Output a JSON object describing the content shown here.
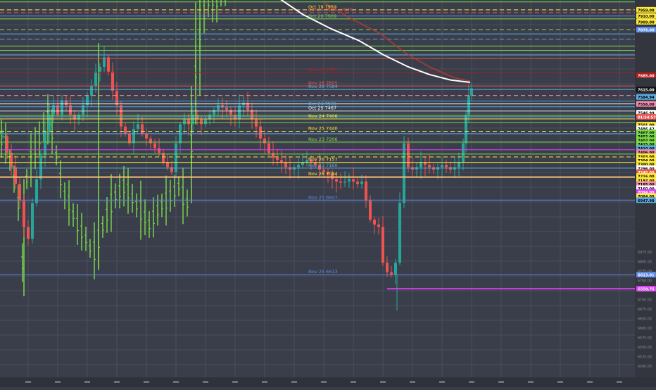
{
  "chart_data": {
    "type": "candlestick",
    "title": "",
    "xlabel": "",
    "ylabel": "",
    "grid": true,
    "ylim": [
      6420,
      8000
    ],
    "colors": {
      "background": "#3a3e4a",
      "grid": "#4a4f5c",
      "up_candle": "#26a69a",
      "down_candle": "#ef5350",
      "green_bars": "#7ddc4a",
      "moving_average": "#ffffff",
      "moving_average_2": "#c0392b",
      "magenta_level": "#e040fb"
    },
    "price_scale_labels": [
      {
        "text": "7959.00",
        "value": 7959,
        "bg": "#ffeb3b",
        "fg": "#000000"
      },
      {
        "text": "7910.00",
        "value": 7933,
        "bg": "#ffeb3b",
        "fg": "#000000"
      },
      {
        "text": "7909.00",
        "value": 7909,
        "bg": "#ffeb3b",
        "fg": "#000000"
      },
      {
        "text": "7876.00",
        "value": 7876,
        "bg": "#5c8ae6",
        "fg": "#ffffff"
      },
      {
        "text": "7685.00",
        "value": 7685,
        "bg": "#b71c1c",
        "fg": "#ffffff"
      },
      {
        "text": "7615.00",
        "value": 7625,
        "bg": "#111111",
        "fg": "#ffffff"
      },
      {
        "text": "7584.94",
        "value": 7594,
        "bg": "#5dade2",
        "fg": "#000000"
      },
      {
        "text": "7556.00",
        "value": 7565,
        "bg": "#f48fb1",
        "fg": "#000000"
      },
      {
        "text": "7546.99",
        "value": 7528,
        "bg": "#ffffff",
        "fg": "#000000"
      },
      {
        "text": "01:54:57",
        "value": 7511,
        "bg": "#ef5350",
        "fg": "#ffffff"
      },
      {
        "text": "7501.00",
        "value": 7478,
        "bg": "#ffeb3b",
        "fg": "#000000"
      },
      {
        "text": "7486.42",
        "value": 7462,
        "bg": "#ffffff",
        "fg": "#000000"
      },
      {
        "text": "7467.00",
        "value": 7446,
        "bg": "#7ddc4a",
        "fg": "#000000"
      },
      {
        "text": "7452.00",
        "value": 7429,
        "bg": "#7ddc4a",
        "fg": "#000000"
      },
      {
        "text": "7402.00",
        "value": 7413,
        "bg": "#7ddc4a",
        "fg": "#000000"
      },
      {
        "text": "7415.00",
        "value": 7397,
        "bg": "#7ddc4a",
        "fg": "#000000"
      },
      {
        "text": "7410.00",
        "value": 7380,
        "bg": "#5dade2",
        "fg": "#000000"
      },
      {
        "text": "7406.00",
        "value": 7363,
        "bg": "#f48fb1",
        "fg": "#000000"
      },
      {
        "text": "7303.00",
        "value": 7346,
        "bg": "#ffeb3b",
        "fg": "#000000"
      },
      {
        "text": "7304.00",
        "value": 7329,
        "bg": "#ffeb3b",
        "fg": "#000000"
      },
      {
        "text": "7300.00",
        "value": 7313,
        "bg": "#ffeb3b",
        "fg": "#000000"
      },
      {
        "text": "7296.00",
        "value": 7296,
        "bg": "#ffffff",
        "fg": "#000000"
      },
      {
        "text": "7245.00",
        "value": 7279,
        "bg": "#ef5350",
        "fg": "#ffffff"
      },
      {
        "text": "7216.00",
        "value": 7263,
        "bg": "#ffeb3b",
        "fg": "#000000"
      },
      {
        "text": "7197.00",
        "value": 7246,
        "bg": "#ffeb3b",
        "fg": "#000000"
      },
      {
        "text": "7185.00",
        "value": 7229,
        "bg": "#f48fb1",
        "fg": "#000000"
      },
      {
        "text": "7160.00",
        "value": 7212,
        "bg": "#ffffff",
        "fg": "#000000"
      },
      {
        "text": "7094.00",
        "value": 7196,
        "bg": "#e040fb",
        "fg": "#ffffff"
      },
      {
        "text": "7084.00",
        "value": 7179,
        "bg": "#ffeb3b",
        "fg": "#000000"
      },
      {
        "text": "6947.98",
        "value": 7162,
        "bg": "#5dade2",
        "fg": "#000000"
      },
      {
        "text": "6613.01",
        "value": 6850,
        "bg": "#5c8ae6",
        "fg": "#ffffff"
      },
      {
        "text": "6550.75",
        "value": 6791,
        "bg": "#e040fb",
        "fg": "#ffffff"
      }
    ],
    "levels": [
      {
        "value": 7992,
        "color": "#7ddc4a",
        "style": "solid"
      },
      {
        "value": 7959,
        "color": "#ffeb3b",
        "style": "dashed",
        "label": "Oct 19 7959"
      },
      {
        "value": 7947,
        "color": "#ef5350",
        "style": "dashed",
        "label": "Oct 25 7959 - 7875"
      },
      {
        "value": 7933,
        "color": "#5c8ae6",
        "style": "solid"
      },
      {
        "value": 7921,
        "color": "#7ddc4a",
        "style": "solid",
        "label": "Oct 20 7909"
      },
      {
        "value": 7876,
        "color": "#7ddc4a",
        "style": "dashed"
      },
      {
        "value": 7858,
        "color": "#5dade2",
        "style": "solid"
      },
      {
        "value": 7836,
        "color": "#5dade2",
        "style": "dashed"
      },
      {
        "value": 7807,
        "color": "#7ddc4a",
        "style": "solid"
      },
      {
        "value": 7789,
        "color": "#7ddc4a",
        "style": "solid"
      },
      {
        "value": 7770,
        "color": "#5dade2",
        "style": "solid"
      },
      {
        "value": 7755,
        "color": "#ef5350",
        "style": "solid"
      },
      {
        "value": 7696,
        "color": "#b71c1c",
        "style": "solid",
        "label": "Nov 26 7685"
      },
      {
        "value": 7640,
        "color": "#ef5350",
        "style": "solid",
        "label": "Nov 28 7605"
      },
      {
        "value": 7625,
        "color": "#5dade2",
        "style": "solid",
        "label": "Nov 28 7584"
      },
      {
        "value": 7600,
        "color": "#f48fb1",
        "style": "dashed"
      },
      {
        "value": 7577,
        "color": "#5dade2",
        "style": "solid"
      },
      {
        "value": 7565,
        "color": "#ffffff",
        "style": "solid"
      },
      {
        "value": 7553,
        "color": "#5dade2",
        "style": "solid",
        "label": "Oct 24 7581"
      },
      {
        "value": 7535,
        "color": "#ffffff",
        "style": "solid",
        "label": "Oct 25 7467"
      },
      {
        "value": 7517,
        "color": "#7ddc4a",
        "style": "solid"
      },
      {
        "value": 7511,
        "color": "#5dade2",
        "style": "solid"
      },
      {
        "value": 7502,
        "color": "#ffeb3b",
        "style": "solid",
        "label": "Nov 24 7406"
      },
      {
        "value": 7486,
        "color": "#7ddc4a",
        "style": "solid"
      },
      {
        "value": 7450,
        "color": "#ffeb3b",
        "style": "dashed",
        "label": "Nov 25 7440"
      },
      {
        "value": 7440,
        "color": "#5dade2",
        "style": "solid"
      },
      {
        "value": 7405,
        "color": "#7ddc4a",
        "style": "solid",
        "label": "Nov 23 7206"
      },
      {
        "value": 7373,
        "color": "#e040fb",
        "style": "solid"
      },
      {
        "value": 7355,
        "color": "#7ddc4a",
        "style": "solid"
      },
      {
        "value": 7343,
        "color": "#ffeb3b",
        "style": "dashed"
      },
      {
        "value": 7320,
        "color": "#ffeb3b",
        "style": "solid",
        "label": "Nov 26 7157"
      },
      {
        "value": 7296,
        "color": "#5dade2",
        "style": "solid",
        "label": "Nov 23 7160"
      },
      {
        "value": 7260,
        "color": "#ffeb3b",
        "style": "solid",
        "label": "Nov 26 7084"
      },
      {
        "value": 7256,
        "color": "#f48fb1",
        "style": "solid"
      },
      {
        "value": 7162,
        "color": "#5c8ae6",
        "style": "solid",
        "label": "Nov 25 6947"
      },
      {
        "value": 6850,
        "color": "#5c8ae6",
        "style": "solid",
        "label": "Nov 25 6613"
      },
      {
        "value": 6791,
        "color": "#e040fb",
        "style": "solid",
        "x_start_fraction": 0.59,
        "width": 2
      }
    ],
    "moving_average": [
      [
        395,
        8010
      ],
      [
        430,
        7940
      ],
      [
        470,
        7880
      ],
      [
        510,
        7830
      ],
      [
        545,
        7770
      ],
      [
        580,
        7720
      ],
      [
        610,
        7688
      ],
      [
        640,
        7665
      ],
      [
        668,
        7655
      ]
    ],
    "moving_average_2": [
      [
        460,
        7990
      ],
      [
        500,
        7920
      ],
      [
        540,
        7860
      ],
      [
        575,
        7780
      ],
      [
        610,
        7720
      ],
      [
        645,
        7675
      ],
      [
        668,
        7660
      ]
    ],
    "volume_scale_labels": [
      "6975.00",
      "6800.00",
      "6775.00",
      "6750.00",
      "6725.00",
      "6700.00",
      "6675.00",
      "6650.00",
      "6600.00",
      "6575.00",
      "6550.00",
      "6525.00",
      "6500.00"
    ]
  }
}
